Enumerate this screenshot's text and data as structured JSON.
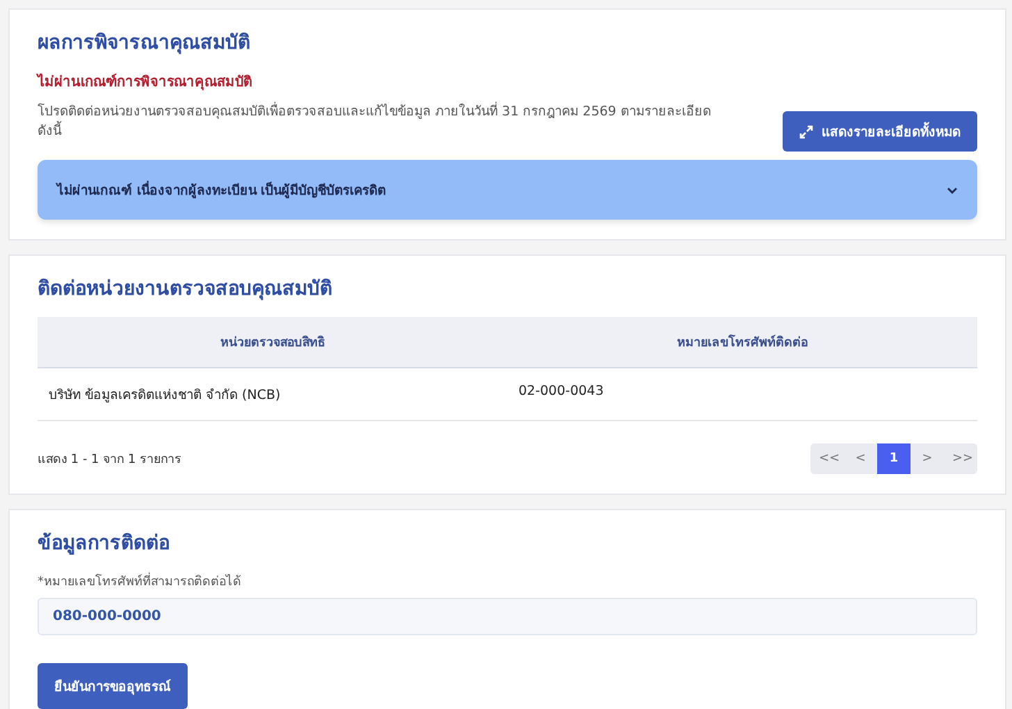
{
  "result": {
    "title": "ผลการพิจารณาคุณสมบัติ",
    "status": "ไม่ผ่านเกณฑ์การพิจารณาคุณสมบัติ",
    "message": "โปรดติดต่อหน่วยงานตรวจสอบคุณสมบัติเพื่อตรวจสอบและแก้ไขข้อมูล ภายในวันที่ 31 กรกฎาคม 2569 ตามรายละเอียดดังนี้",
    "details_button": "แสดงรายละเอียดทั้งหมด",
    "reasons": [
      {
        "text": "ไม่ผ่านเกณฑ์ เนื่องจากผู้ลงทะเบียน เป็นผู้มีบัญชีบัตรเครดิต",
        "expanded": false
      }
    ]
  },
  "agencies": {
    "title": "ติดต่อหน่วยงานตรวจสอบคุณสมบัติ",
    "columns": [
      "หน่วยตรวจสอบสิทธิ",
      "หมายเลขโทรศัพท์ติดต่อ"
    ],
    "rows": [
      [
        "บริษัท ข้อมูลเครดิตแห่งชาติ จำกัด (NCB)",
        "02-000-0043"
      ]
    ],
    "summary": "แสดง 1 - 1 จาก 1 รายการ",
    "pagination": [
      {
        "label": "<<",
        "selected": false
      },
      {
        "label": "<",
        "selected": false
      },
      {
        "label": "1",
        "selected": true
      },
      {
        "label": ">",
        "selected": false
      },
      {
        "label": ">>",
        "selected": false
      }
    ]
  },
  "contact": {
    "title": "ข้อมูลการติดต่อ",
    "field_label": "*หมายเลขโทรศัพท์ที่สามารถติดต่อได้",
    "field_value": "080-000-0000",
    "submit": "ยืนยันการขออุทธรณ์"
  }
}
